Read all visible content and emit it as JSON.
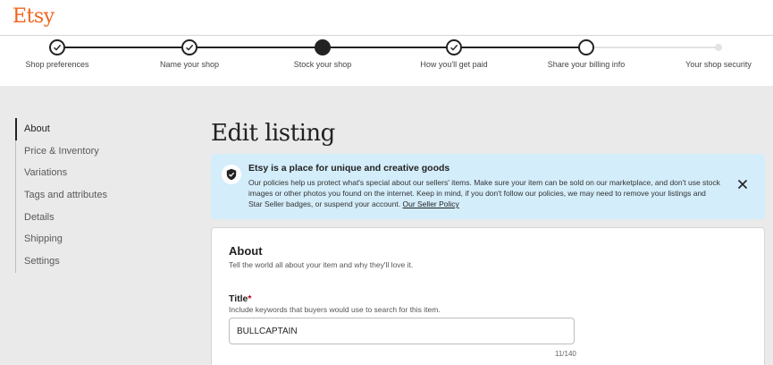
{
  "brand": {
    "logo_text": "Etsy",
    "accent_color": "#f1641e"
  },
  "progress": {
    "steps": [
      {
        "label": "Shop preferences",
        "state": "completed"
      },
      {
        "label": "Name your shop",
        "state": "completed"
      },
      {
        "label": "Stock your shop",
        "state": "current"
      },
      {
        "label": "How you'll get paid",
        "state": "completed"
      },
      {
        "label": "Share your billing info",
        "state": "upcoming"
      },
      {
        "label": "Your shop security",
        "state": "upcoming"
      }
    ]
  },
  "sidebar": {
    "items": [
      {
        "label": "About",
        "active": true
      },
      {
        "label": "Price & Inventory",
        "active": false
      },
      {
        "label": "Variations",
        "active": false
      },
      {
        "label": "Tags and attributes",
        "active": false
      },
      {
        "label": "Details",
        "active": false
      },
      {
        "label": "Shipping",
        "active": false
      },
      {
        "label": "Settings",
        "active": false
      }
    ]
  },
  "page_title": "Edit listing",
  "notice": {
    "title": "Etsy is a place for unique and creative goods",
    "body": "Our policies help us protect what's special about our sellers' items. Make sure your item can be sold on our marketplace, and don't use stock images or other photos you found on the internet. Keep in mind, if you don't follow our policies, we may need to remove your listings and Star Seller badges, or suspend your account.",
    "link_text": "Our Seller Policy",
    "background_color": "#d4edfb"
  },
  "about_section": {
    "title": "About",
    "subtitle": "Tell the world all about your item and why they'll love it.",
    "title_field": {
      "label": "Title",
      "required_marker": "*",
      "help": "Include keywords that buyers would use to search for this item.",
      "value": "BULLCAPTAIN",
      "char_count": "11/140"
    }
  }
}
